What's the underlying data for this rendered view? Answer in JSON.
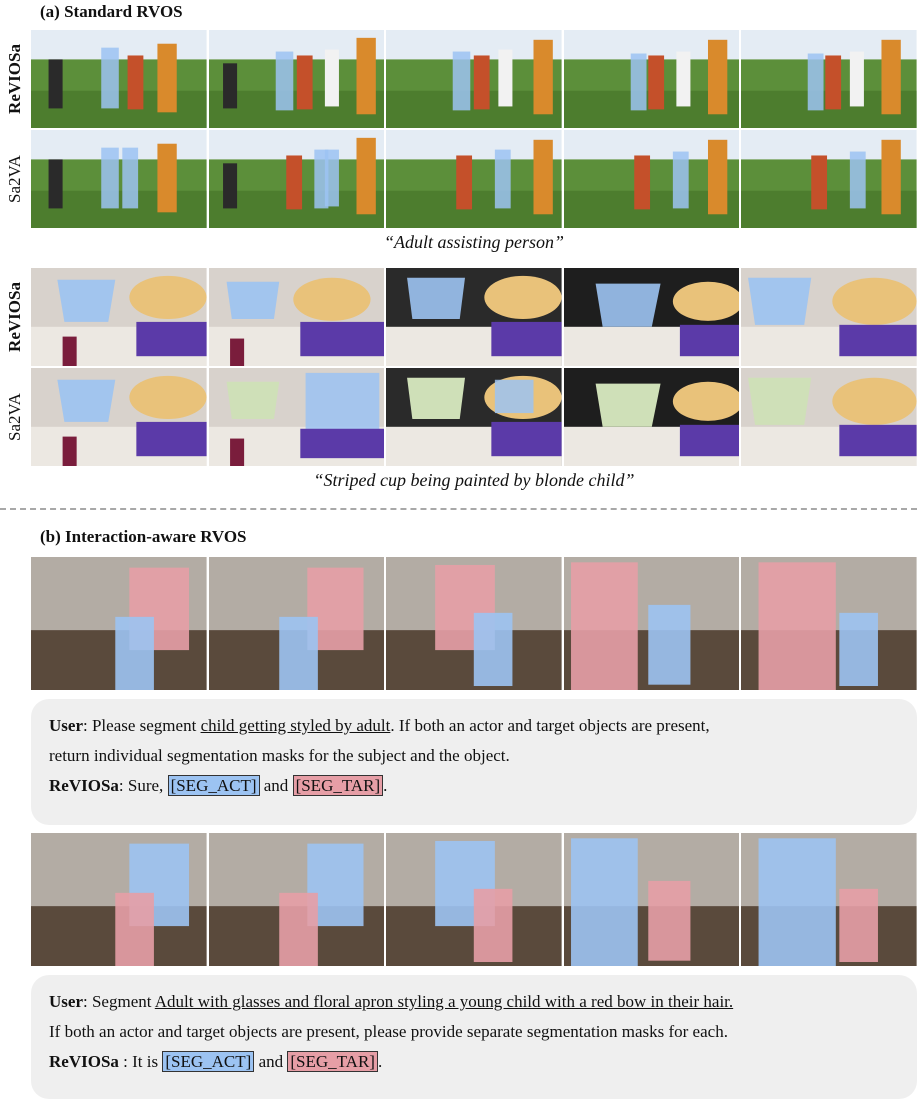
{
  "section_a": {
    "title": "(a) Standard RVOS",
    "example1": {
      "row_labels": [
        "ReVIOSa",
        "Sa2VA"
      ],
      "caption": "“Adult assisting person”"
    },
    "example2": {
      "row_labels": [
        "ReVIOSa",
        "Sa2VA"
      ],
      "caption": "“Striped cup being painted by blonde child”"
    }
  },
  "section_b": {
    "title": "(b) Interaction-aware RVOS",
    "chat1": {
      "user_label": "User",
      "sep": ": ",
      "pre": "Please segment ",
      "query": "child getting styled by adult",
      "post": ". If both an actor and target objects are present,",
      "line2": "return individual segmentation masks for the subject and the object.",
      "model_label": "ReVIOSa",
      "model_sep": ": ",
      "resp_pre": "Sure, ",
      "tok_act": "[SEG_ACT]",
      "and": " and ",
      "tok_tar": "[SEG_TAR]",
      "end": "."
    },
    "chat2": {
      "user_label": "User",
      "sep": ": ",
      "pre": "Segment ",
      "query": "Adult with glasses and floral apron styling a young child with a red bow in their hair.",
      "line2": "If both an actor and target objects are present, please provide separate segmentation masks for each.",
      "model_label": "ReVIOSa",
      "model_sep": " : ",
      "resp_pre": "It is ",
      "tok_act": "[SEG_ACT]",
      "and": " and ",
      "tok_tar": "[SEG_TAR]",
      "end": "."
    }
  },
  "colors": {
    "actor_mask": "#9cc3f2",
    "target_mask": "#e69ea6"
  }
}
